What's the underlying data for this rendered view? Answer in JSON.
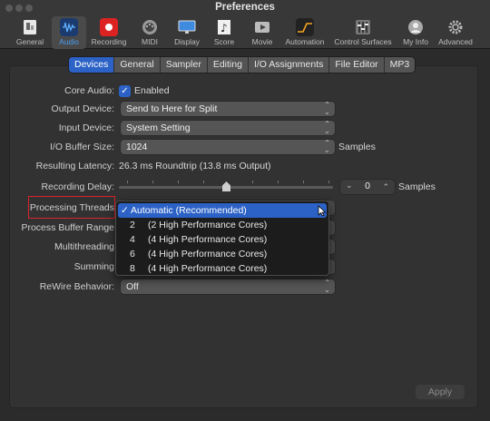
{
  "window": {
    "title": "Preferences"
  },
  "toolbar": {
    "items": [
      {
        "label": "General",
        "icon": "general-icon"
      },
      {
        "label": "Audio",
        "icon": "audio-icon"
      },
      {
        "label": "Recording",
        "icon": "record-icon"
      },
      {
        "label": "MIDI",
        "icon": "midi-icon"
      },
      {
        "label": "Display",
        "icon": "display-icon"
      },
      {
        "label": "Score",
        "icon": "score-icon"
      },
      {
        "label": "Movie",
        "icon": "movie-icon"
      },
      {
        "label": "Automation",
        "icon": "automation-icon"
      },
      {
        "label": "Control Surfaces",
        "icon": "control-surfaces-icon"
      },
      {
        "label": "My Info",
        "icon": "my-info-icon"
      },
      {
        "label": "Advanced",
        "icon": "advanced-icon"
      }
    ]
  },
  "tabs": [
    "Devices",
    "General",
    "Sampler",
    "Editing",
    "I/O Assignments",
    "File Editor",
    "MP3"
  ],
  "fields": {
    "core_audio_label": "Core Audio:",
    "core_audio_value": "Enabled",
    "output_device_label": "Output Device:",
    "output_device_value": "Send to Here for Split",
    "input_device_label": "Input Device:",
    "input_device_value": "System Setting",
    "buffer_size_label": "I/O Buffer Size:",
    "buffer_size_value": "1024",
    "buffer_size_unit": "Samples",
    "latency_label": "Resulting Latency:",
    "latency_value": "26.3 ms Roundtrip (13.8 ms Output)",
    "recording_delay_label": "Recording Delay:",
    "recording_delay_value": "0",
    "recording_delay_unit": "Samples",
    "processing_threads_label": "Processing Threads",
    "process_buffer_label": "Process Buffer Range",
    "multithreading_label": "Multithreading",
    "summing_label": "Summing",
    "rewire_label": "ReWire Behavior:",
    "rewire_value": "Off"
  },
  "processing_threads_menu": [
    {
      "check": "✓",
      "number": "",
      "text": "Automatic (Recommended)"
    },
    {
      "check": "",
      "number": "2",
      "text": "(2 High Performance Cores)"
    },
    {
      "check": "",
      "number": "4",
      "text": "(4 High Performance Cores)"
    },
    {
      "check": "",
      "number": "6",
      "text": "(4 High Performance Cores)"
    },
    {
      "check": "",
      "number": "8",
      "text": "(4 High Performance Cores)"
    }
  ],
  "buttons": {
    "apply": "Apply"
  },
  "colors": {
    "accent": "#2c62c6",
    "highlight_box": "#d8222a"
  }
}
